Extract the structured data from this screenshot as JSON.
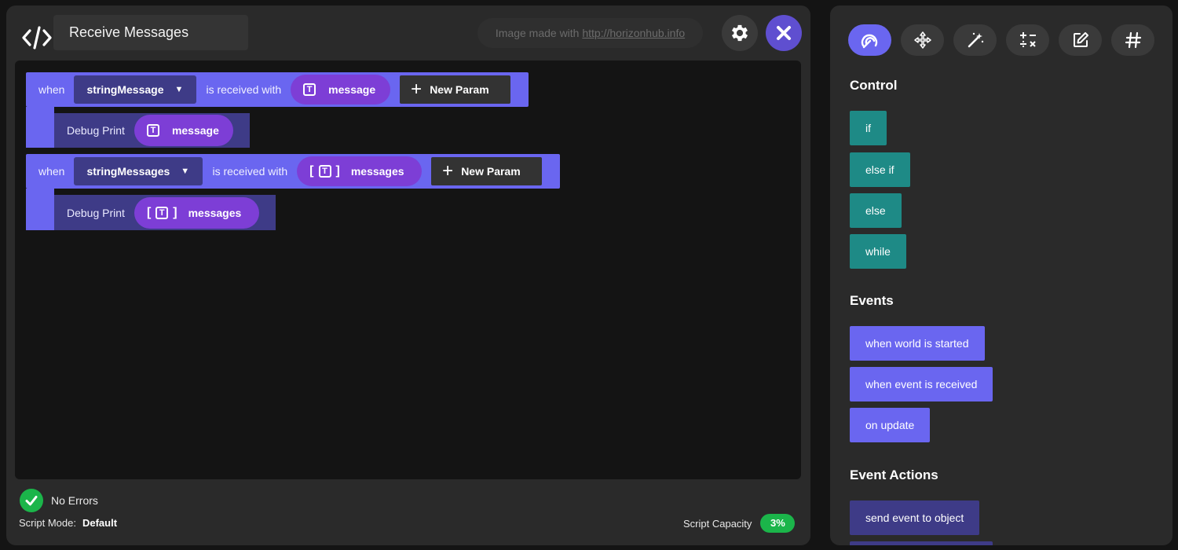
{
  "editor": {
    "script_name": "Receive Messages",
    "watermark_prefix": "Image made with ",
    "watermark_link": "http://horizonhub.info"
  },
  "blocks": [
    {
      "when_label": "when",
      "event_name": "stringMessage",
      "received_label": "is received with",
      "param_name": "message",
      "param_type": "text",
      "new_param_label": "New Param",
      "action_label": "Debug Print",
      "action_arg": "message"
    },
    {
      "when_label": "when",
      "event_name": "stringMessages",
      "received_label": "is received with",
      "param_name": "messages",
      "param_type": "text-array",
      "new_param_label": "New Param",
      "action_label": "Debug Print",
      "action_arg": "messages"
    }
  ],
  "status": {
    "errors_text": "No Errors",
    "mode_label": "Script Mode:",
    "mode_value": "Default",
    "capacity_label": "Script Capacity",
    "capacity_value": "3%"
  },
  "palette": {
    "tabs": [
      "control-flow-icon",
      "move-arrows-icon",
      "magic-wand-icon",
      "math-operators-icon",
      "edit-icon",
      "hash-icon"
    ],
    "sections": {
      "control": {
        "title": "Control",
        "items": [
          "if",
          "else if",
          "else",
          "while"
        ]
      },
      "events": {
        "title": "Events",
        "items": [
          "when world is started",
          "when event is received",
          "on update"
        ]
      },
      "event_actions": {
        "title": "Event Actions",
        "items": [
          "send event to object"
        ]
      }
    }
  },
  "colors": {
    "event_block": "#6a66f0",
    "dropdown": "#3e3b87",
    "param": "#7d3ed6",
    "control": "#1e8a86",
    "success": "#1bb54a",
    "close": "#5f4fd0"
  }
}
